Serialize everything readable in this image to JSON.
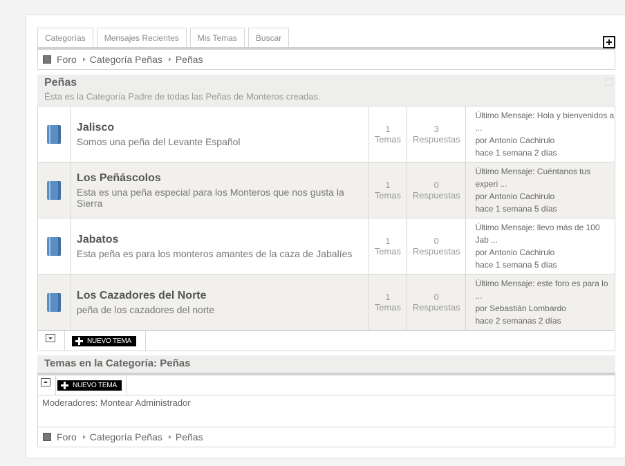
{
  "tabs": [
    "Categorías",
    "Mensajes Recientes",
    "Mis Temas",
    "Buscar"
  ],
  "breadcrumb": [
    "Foro",
    "Categoría Peñas",
    "Peñas"
  ],
  "category": {
    "title": "Peñas",
    "description": "Ésta es la Categoría Padre de todas las Peñas de Monteros creadas."
  },
  "forums": [
    {
      "name": "Jalisco",
      "desc": "Somos una peña del Levante Español",
      "topics": "1",
      "topics_label": "Temas",
      "replies": "3",
      "replies_label": "Respuestas",
      "last_msg": "Último Mensaje: Hola y bienvenidos a ...",
      "last_by": "por Antonio Cachirulo",
      "last_when": "hace 1 semana 2 días"
    },
    {
      "name": "Los Peñáscolos",
      "desc": "Esta es una peña especial para los Monteros que nos gusta la Sierra",
      "topics": "1",
      "topics_label": "Temas",
      "replies": "0",
      "replies_label": "Respuestas",
      "last_msg": "Último Mensaje: Cuéntanos tus experi ...",
      "last_by": "por Antonio Cachirulo",
      "last_when": "hace 1 semana 5 días"
    },
    {
      "name": "Jabatos",
      "desc": "Esta peña es para los monteros amantes de la caza de Jabalíes",
      "topics": "1",
      "topics_label": "Temas",
      "replies": "0",
      "replies_label": "Respuestas",
      "last_msg": "Último Mensaje: llevo más de 100 Jab ...",
      "last_by": "por Antonio Cachirulo",
      "last_when": "hace 1 semana 5 días"
    },
    {
      "name": "Los Cazadores del Norte",
      "desc": "peña de los cazadores del norte",
      "topics": "1",
      "topics_label": "Temas",
      "replies": "0",
      "replies_label": "Respuestas",
      "last_msg": "Último Mensaje: este foro es para lo ...",
      "last_by": "por Sebastián Lombardo",
      "last_when": "hace 2 semanas 2 días"
    }
  ],
  "new_topic_label": "NUEVO TEMA",
  "topics_section_title": "Temas en la Categoría: Peñas",
  "moderators": "Moderadores: Montear Administrador"
}
